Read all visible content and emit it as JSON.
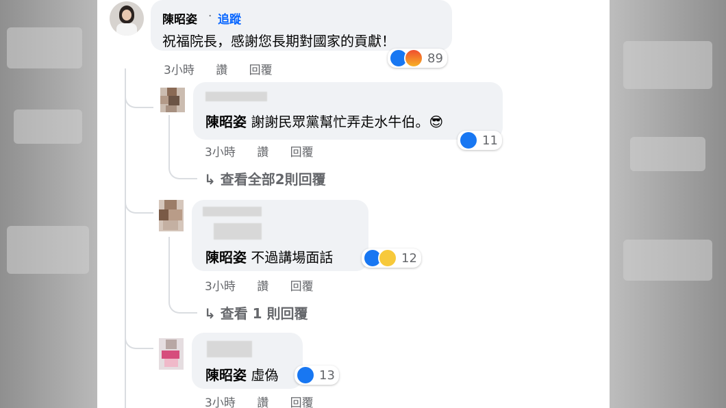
{
  "main_comment": {
    "author": "陳昭姿",
    "separator": "·",
    "follow_label": "追蹤",
    "text": "祝福院長，感謝您長期對國家的貢獻！",
    "time": "3小時",
    "like_label": "讚",
    "reply_label": "回覆",
    "reaction_count": "89"
  },
  "replies": [
    {
      "mention": "陳昭姿",
      "text": "謝謝民眾黨幫忙弄走水牛伯。😎",
      "time": "3小時",
      "like_label": "讚",
      "reply_label": "回覆",
      "reaction_count": "11",
      "view_more": "↳ 查看全部2則回覆"
    },
    {
      "mention": "陳昭姿",
      "text": "不過講場面話",
      "time": "3小時",
      "like_label": "讚",
      "reply_label": "回覆",
      "reaction_count": "12",
      "view_more": "↳ 查看 1 則回覆"
    },
    {
      "mention": "陳昭姿",
      "text": "虛偽",
      "time": "3小時",
      "like_label": "讚",
      "reply_label": "回覆",
      "reaction_count": "13"
    }
  ],
  "colors": {
    "link": "#0866ff",
    "bubble": "#f0f2f5",
    "like": "#1877f2",
    "meta": "#65676b"
  },
  "icons": [
    "like-icon",
    "angry-icon",
    "haha-icon"
  ]
}
